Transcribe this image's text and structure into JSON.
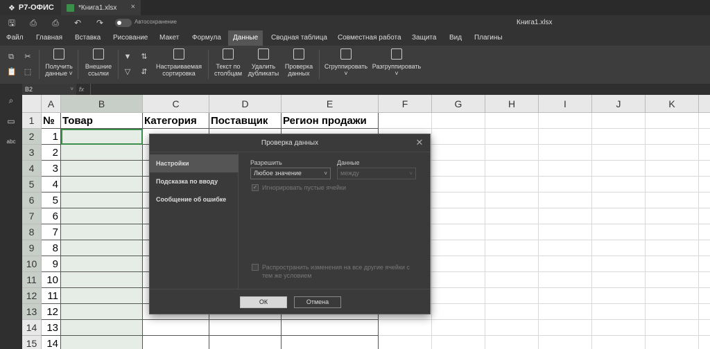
{
  "app": {
    "brand": "Р7-ОФИС",
    "doc_tab": "*Книга1.xlsx",
    "window_title": "Книга1.xlsx",
    "autosave_label": "Автосохранение"
  },
  "menu": [
    "Файл",
    "Главная",
    "Вставка",
    "Рисование",
    "Макет",
    "Формула",
    "Данные",
    "Сводная таблица",
    "Совместная работа",
    "Защита",
    "Вид",
    "Плагины"
  ],
  "menu_active": "Данные",
  "ribbon": {
    "get_data": [
      "Получить",
      "данные ˅"
    ],
    "ext_links": [
      "Внешние",
      "ссылки"
    ],
    "custom_sort": [
      "Настраиваемая",
      "сортировка"
    ],
    "text_to_cols": [
      "Текст по",
      "столбцам"
    ],
    "remove_dup": [
      "Удалить",
      "дубликаты"
    ],
    "validation": [
      "Проверка",
      "данных"
    ],
    "group": "Сгруппировать",
    "ungroup": "Разгруппировать",
    "chev": "˅"
  },
  "formula": {
    "cell_ref": "B2",
    "fx": "fx"
  },
  "columns": [
    "A",
    "B",
    "C",
    "D",
    "E",
    "F",
    "G",
    "H",
    "I",
    "J",
    "K"
  ],
  "rows": [
    "1",
    "2",
    "3",
    "4",
    "5",
    "6",
    "7",
    "8",
    "9",
    "10",
    "11",
    "12",
    "13",
    "14",
    "15"
  ],
  "header_row": [
    "№",
    "Товар",
    "Категория",
    "Поставщик",
    "Регион продажи"
  ],
  "numbers": [
    "1",
    "2",
    "3",
    "4",
    "5",
    "6",
    "7",
    "8",
    "9",
    "10",
    "11",
    "12",
    "13",
    "14"
  ],
  "dialog": {
    "title": "Проверка данных",
    "tabs": [
      "Настройки",
      "Подсказка по вводу",
      "Сообщение об ошибке"
    ],
    "allow_label": "Разрешить",
    "allow_value": "Любое значение",
    "data_label": "Данные",
    "data_value": "между",
    "ignore_blank": "Игнорировать пустые ячейки",
    "apply_all": [
      "Распространить изменения на все другие ячейки с",
      "тем же условием"
    ],
    "ok": "ОК",
    "cancel": "Отмена"
  },
  "colors": {
    "accent_tab": "#555555",
    "dialog_bg": "#3a3a3a",
    "selection": "#e6ece6"
  }
}
